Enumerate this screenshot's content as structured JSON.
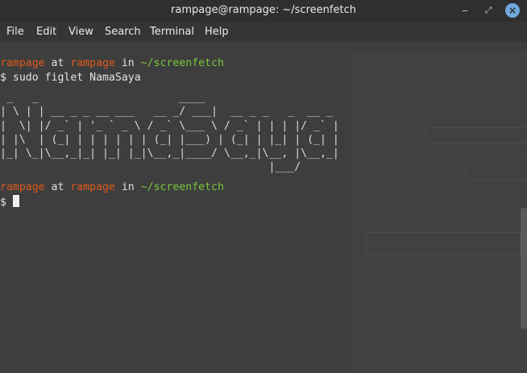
{
  "window": {
    "title": "rampage@rampage: ~/screenfetch"
  },
  "menu": [
    "File",
    "Edit",
    "View",
    "Search",
    "Terminal",
    "Help"
  ],
  "prompt1": {
    "user": "rampage",
    "at": " at ",
    "host": "rampage",
    "in": " in ",
    "path": "~/screenfetch"
  },
  "command": "$ sudo figlet NamaSaya",
  "figlet": [
    " _   _                      ____                    ",
    "| \\ | | __ _ _ __ ___   __ _/ ___|  __ _ _   _  __ _ ",
    "|  \\| |/ _` | '_ ` _ \\ / _` \\___ \\ / _` | | | |/ _` |",
    "| |\\  | (_| | | | | | | (_| |___) | (_| | |_| | (_| |",
    "|_| \\_|\\__,_|_| |_| |_|\\__,_|____/ \\__,_|\\__, |\\__,_|",
    "                                          |___/      "
  ],
  "prompt2": {
    "user": "rampage",
    "at": " at ",
    "host": "rampage",
    "in": " in ",
    "path": "~/screenfetch"
  },
  "prompt_symbol": "$ ",
  "colors": {
    "user": "#e05a1c",
    "path": "#77c83a",
    "close_button": "#6fa8dc"
  }
}
